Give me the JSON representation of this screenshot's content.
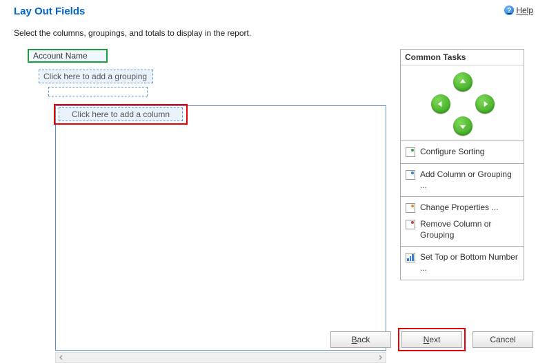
{
  "header": {
    "title": "Lay Out Fields",
    "help_label": "Help"
  },
  "instruction": "Select the columns, groupings, and totals to display in the report.",
  "fields": {
    "account_name": "Account Name",
    "add_grouping": "Click here to add a grouping",
    "add_column": "Click here to add a column"
  },
  "tasks": {
    "header": "Common Tasks",
    "configure_sorting": "Configure Sorting",
    "add_column_grouping": "Add Column or Grouping ...",
    "change_properties": "Change Properties ...",
    "remove_column_grouping": "Remove Column or Grouping",
    "set_top_bottom": "Set Top or Bottom Number ..."
  },
  "footer": {
    "back": "ack",
    "back_u": "B",
    "next": "ext",
    "next_u": "N",
    "cancel": "Cancel"
  }
}
